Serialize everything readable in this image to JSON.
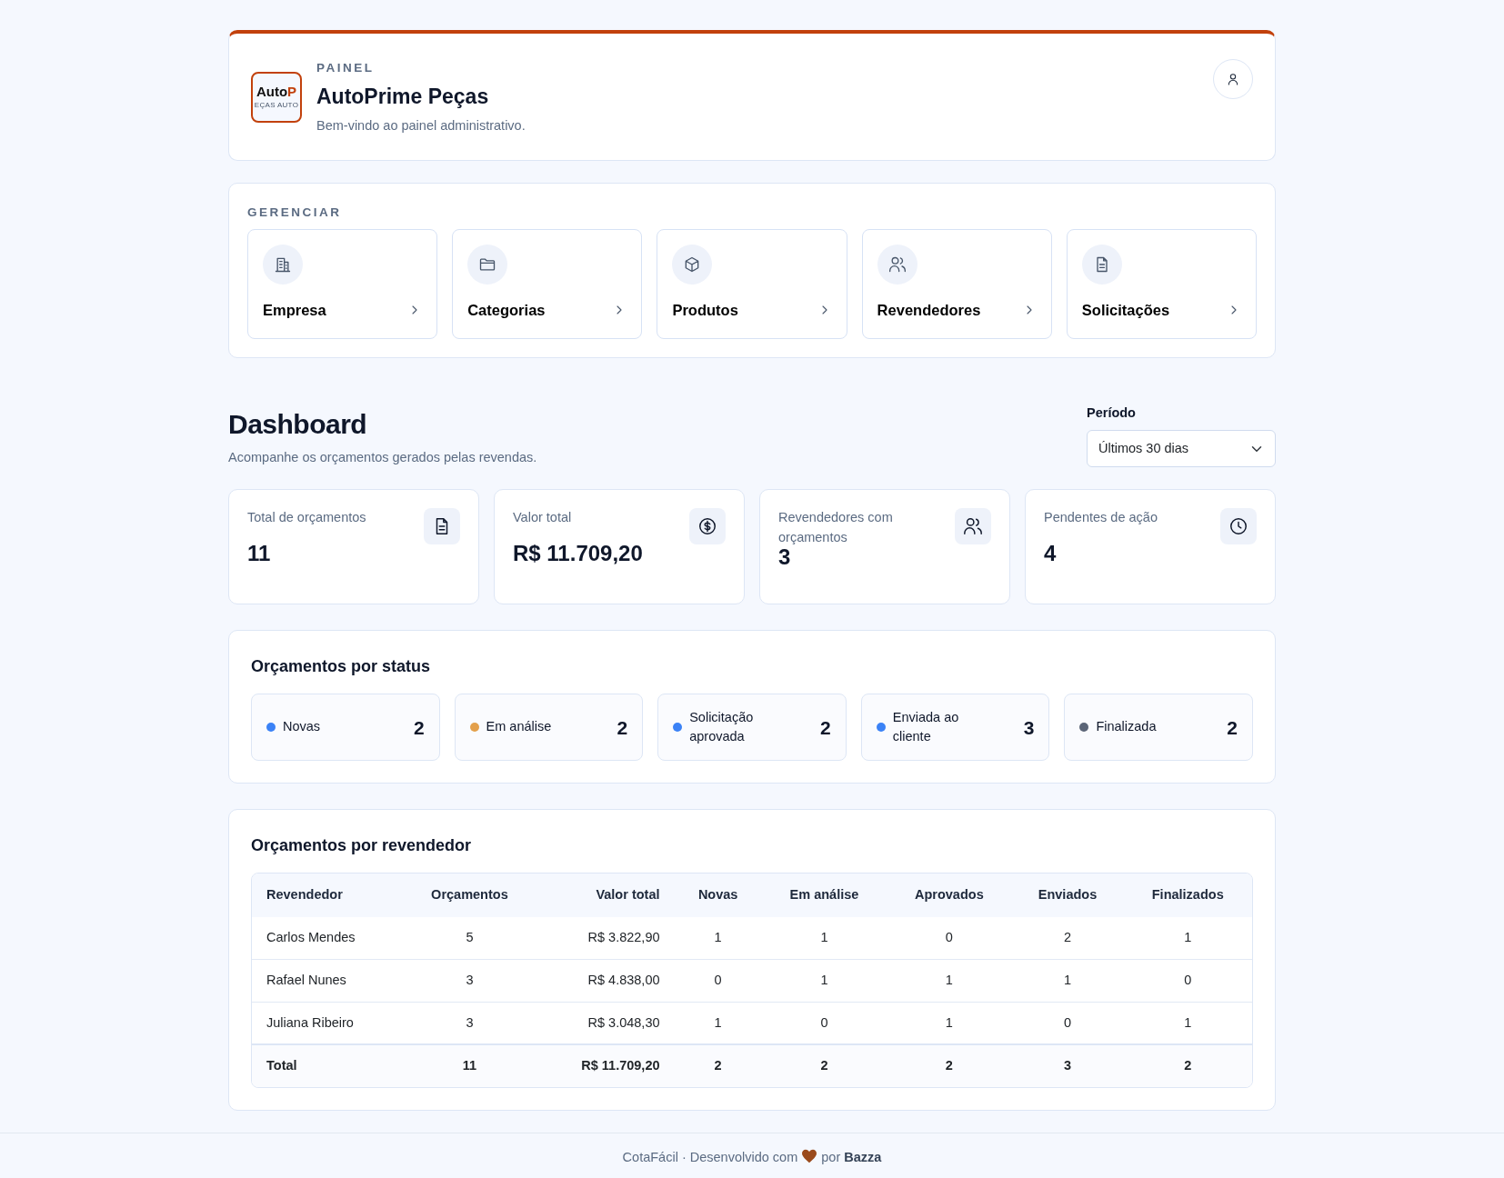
{
  "header": {
    "logo": {
      "word": "Auto",
      "accent": "P",
      "tagline": "EÇAS AUTO"
    },
    "eyebrow": "PAINEL",
    "title": "AutoPrime Peças",
    "subtitle": "Bem-vindo ao painel administrativo."
  },
  "manage": {
    "title": "GERENCIAR",
    "items": [
      {
        "label": "Empresa"
      },
      {
        "label": "Categorias"
      },
      {
        "label": "Produtos"
      },
      {
        "label": "Revendedores"
      },
      {
        "label": "Solicitações"
      }
    ]
  },
  "dashboard": {
    "title": "Dashboard",
    "subtitle": "Acompanhe os orçamentos gerados pelas revendas.",
    "period": {
      "label": "Período",
      "value": "Últimos 30 dias"
    }
  },
  "stats": [
    {
      "label": "Total de orçamentos",
      "value": "11"
    },
    {
      "label": "Valor total",
      "value": "R$ 11.709,20"
    },
    {
      "label": "Revendedores com orçamentos",
      "value": "3"
    },
    {
      "label": "Pendentes de ação",
      "value": "4"
    }
  ],
  "status": {
    "title": "Orçamentos por status",
    "items": [
      {
        "label": "Novas",
        "count": "2",
        "color": "#3b82f6"
      },
      {
        "label": "Em análise",
        "count": "2",
        "color": "#e3a04b"
      },
      {
        "label": "Solicitação aprovada",
        "count": "2",
        "color": "#3b82f6"
      },
      {
        "label": "Enviada ao cliente",
        "count": "3",
        "color": "#3b82f6"
      },
      {
        "label": "Finalizada",
        "count": "2",
        "color": "#5b6577"
      }
    ]
  },
  "table": {
    "title": "Orçamentos por revendedor",
    "columns": [
      "Revendedor",
      "Orçamentos",
      "Valor total",
      "Novas",
      "Em análise",
      "Aprovados",
      "Enviados",
      "Finalizados"
    ],
    "rows": [
      [
        "Carlos Mendes",
        "5",
        "R$ 3.822,90",
        "1",
        "1",
        "0",
        "2",
        "1"
      ],
      [
        "Rafael Nunes",
        "3",
        "R$ 4.838,00",
        "0",
        "1",
        "1",
        "1",
        "0"
      ],
      [
        "Juliana Ribeiro",
        "3",
        "R$ 3.048,30",
        "1",
        "0",
        "1",
        "0",
        "1"
      ]
    ],
    "total": [
      "Total",
      "11",
      "R$ 11.709,20",
      "2",
      "2",
      "2",
      "3",
      "2"
    ]
  },
  "footer": {
    "text": "CotaFácil · Desenvolvido com",
    "by": "por **Bazza**"
  }
}
